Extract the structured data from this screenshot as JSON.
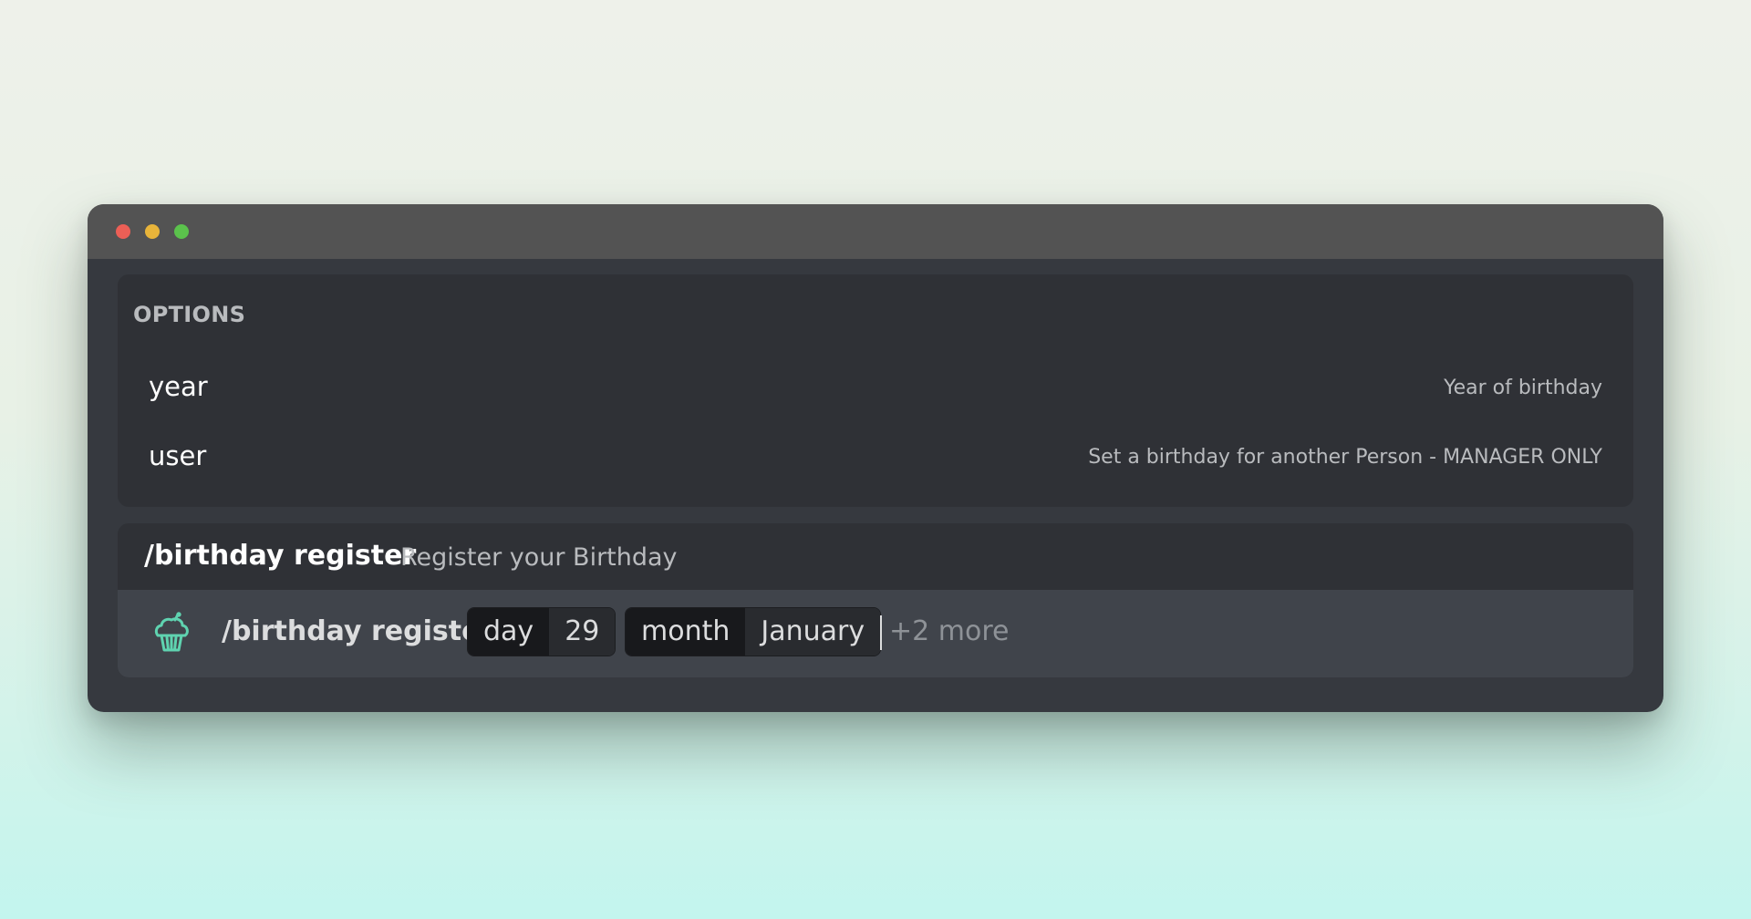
{
  "options": {
    "header": "OPTIONS",
    "items": [
      {
        "name": "year",
        "description": "Year of birthday"
      },
      {
        "name": "user",
        "description": "Set a birthday for another Person - MANAGER ONLY"
      }
    ]
  },
  "command": {
    "name": "/birthday register",
    "description": "Register your Birthday"
  },
  "input": {
    "command": "/birthday register",
    "params": [
      {
        "name": "day",
        "value": "29"
      },
      {
        "name": "month",
        "value": "January"
      }
    ],
    "more": "+2 more",
    "icon": "cupcake-icon"
  },
  "colors": {
    "window_bg": "#36393f",
    "titlebar": "#535353",
    "panel": "#2f3136",
    "input_bg": "#40444b",
    "icon_accent": "#5fd3b0",
    "close": "#ec5f56",
    "minimize": "#e8b43a",
    "maximize": "#5bc24c"
  }
}
